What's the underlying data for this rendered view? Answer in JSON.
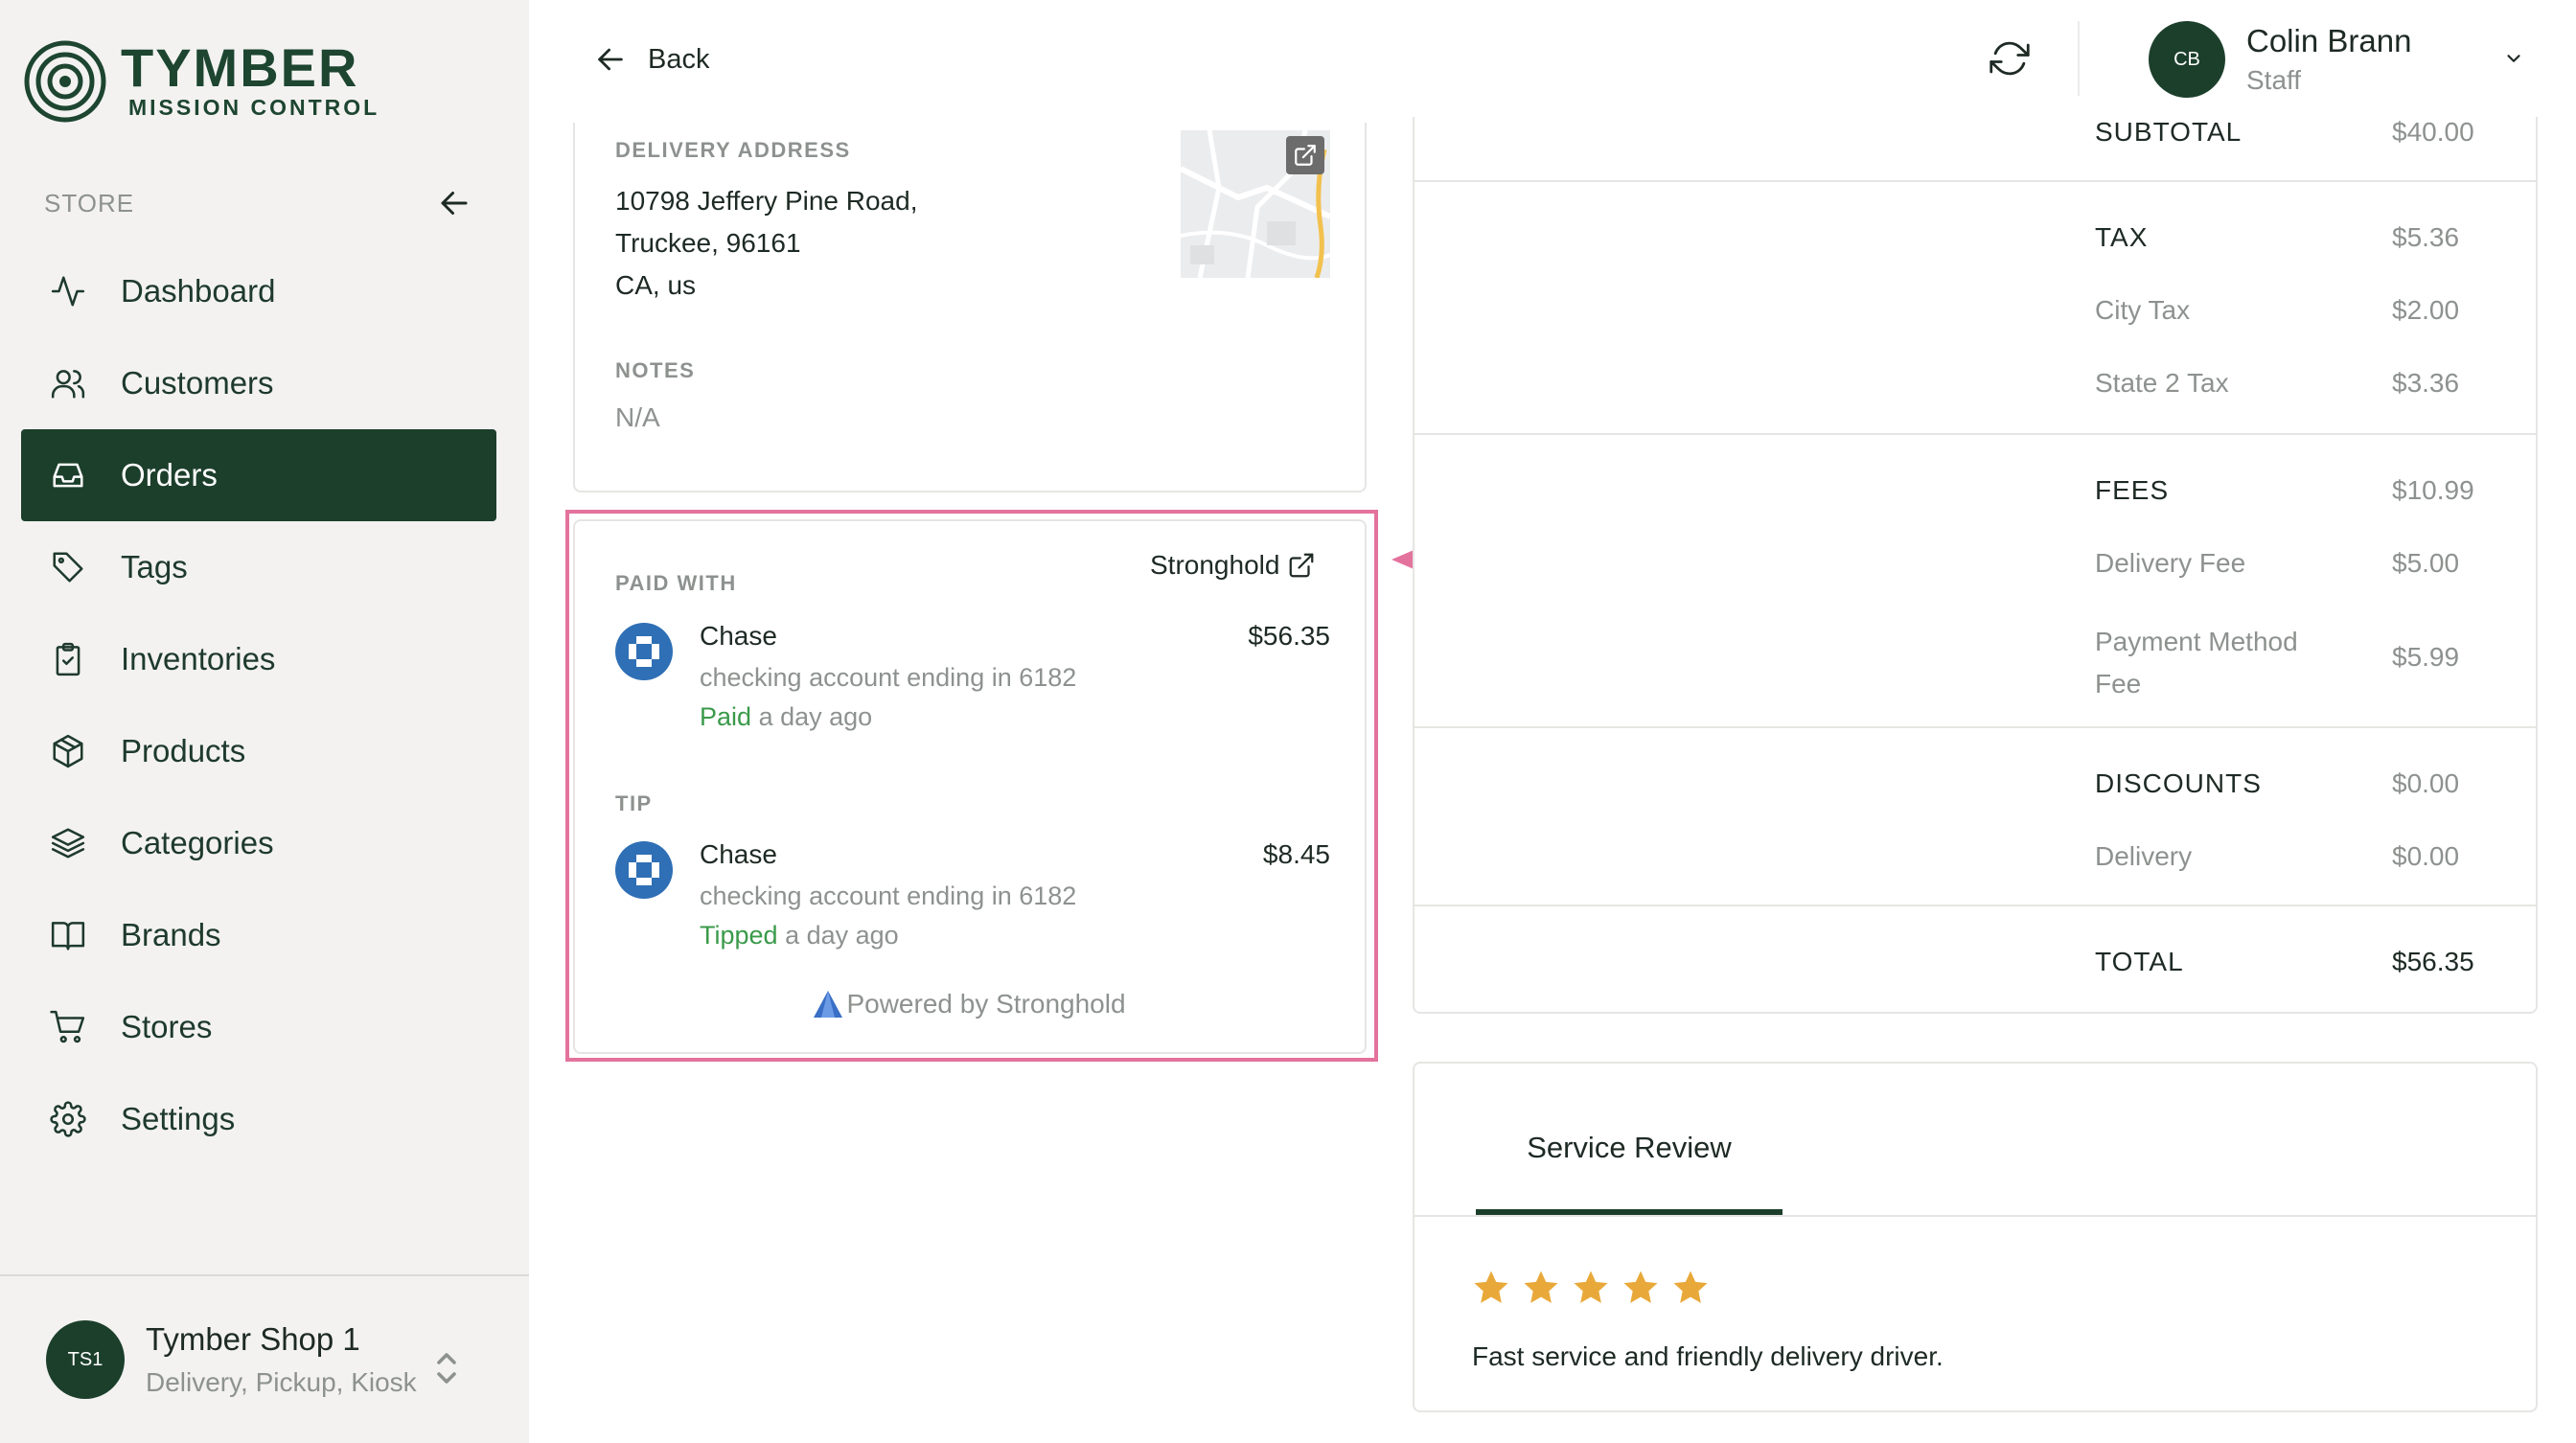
{
  "brand": {
    "name": "TYMBER",
    "subtitle": "MISSION CONTROL"
  },
  "sidebar": {
    "section_label": "STORE",
    "items": [
      {
        "label": "Dashboard",
        "icon": "activity-icon",
        "active": false
      },
      {
        "label": "Customers",
        "icon": "users-icon",
        "active": false
      },
      {
        "label": "Orders",
        "icon": "inbox-icon",
        "active": true
      },
      {
        "label": "Tags",
        "icon": "tag-icon",
        "active": false
      },
      {
        "label": "Inventories",
        "icon": "clipboard-check-icon",
        "active": false
      },
      {
        "label": "Products",
        "icon": "box-icon",
        "active": false
      },
      {
        "label": "Categories",
        "icon": "layers-icon",
        "active": false
      },
      {
        "label": "Brands",
        "icon": "book-open-icon",
        "active": false
      },
      {
        "label": "Stores",
        "icon": "cart-icon",
        "active": false
      },
      {
        "label": "Settings",
        "icon": "gear-icon",
        "active": false
      }
    ],
    "shop": {
      "initials": "TS1",
      "name": "Tymber Shop 1",
      "modes": "Delivery, Pickup, Kiosk"
    }
  },
  "topbar": {
    "back_label": "Back",
    "user": {
      "initials": "CB",
      "name": "Colin Brann",
      "role": "Staff"
    }
  },
  "address_card": {
    "address_label": "DELIVERY ADDRESS",
    "address_lines": [
      "10798 Jeffery Pine Road,",
      "Truckee, 96161",
      "CA, us"
    ],
    "notes_label": "NOTES",
    "notes_value": "N/A"
  },
  "payment_card": {
    "paid_label": "PAID WITH",
    "provider": "Stronghold",
    "payment": {
      "bank": "Chase",
      "account": "checking account ending in 6182",
      "status_word": "Paid",
      "status_time": "a day ago",
      "amount": "$56.35"
    },
    "tip_label": "TIP",
    "tip": {
      "bank": "Chase",
      "account": "checking account ending in 6182",
      "status_word": "Tipped",
      "status_time": "a day ago",
      "amount": "$8.45"
    },
    "powered_by": "Powered by Stronghold"
  },
  "summary": {
    "subtotal": {
      "label": "SUBTOTAL",
      "value": "$40.00"
    },
    "tax": {
      "label": "TAX",
      "value": "$5.36"
    },
    "tax_items": [
      {
        "label": "City Tax",
        "value": "$2.00"
      },
      {
        "label": "State 2 Tax",
        "value": "$3.36"
      }
    ],
    "fees": {
      "label": "FEES",
      "value": "$10.99"
    },
    "fee_items": [
      {
        "label": "Delivery Fee",
        "value": "$5.00"
      },
      {
        "label_line1": "Payment Method",
        "label_line2": "Fee",
        "value": "$5.99"
      }
    ],
    "discounts": {
      "label": "DISCOUNTS",
      "value": "$0.00"
    },
    "discount_items": [
      {
        "label": "Delivery",
        "value": "$0.00"
      }
    ],
    "total": {
      "label": "TOTAL",
      "value": "$56.35"
    }
  },
  "review": {
    "tab_label": "Service Review",
    "rating": 5,
    "max_rating": 5,
    "comment": "Fast service and friendly delivery driver."
  },
  "colors": {
    "brand_green": "#1c3f2b",
    "highlight_pink": "#e3739c",
    "star_gold": "#e9a93a",
    "paid_green": "#3a9a4a",
    "chase_blue": "#2f6fb5"
  }
}
